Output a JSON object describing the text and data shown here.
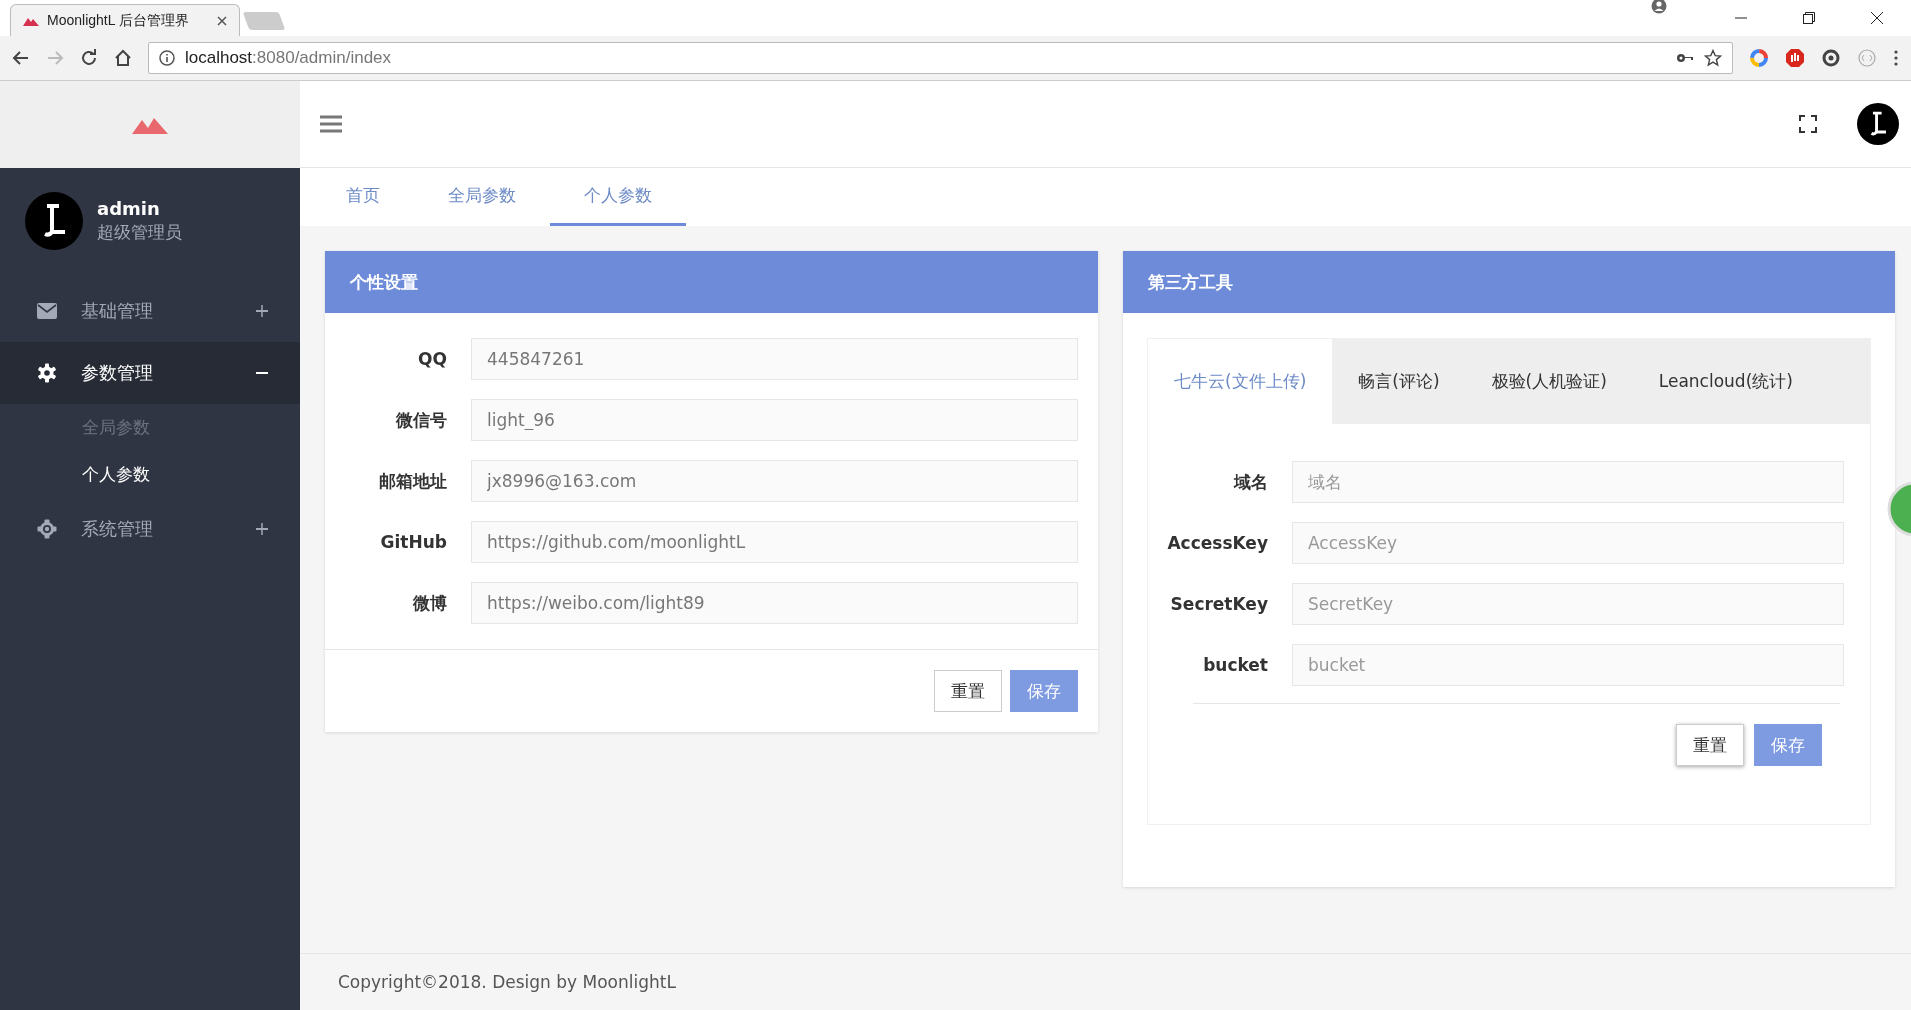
{
  "browser": {
    "tab_title": "MoonlightL 后台管理界",
    "url_host": "localhost",
    "url_rest": ":8080/admin/index"
  },
  "sidebar": {
    "user": {
      "name": "admin",
      "role": "超级管理员"
    },
    "menu": [
      {
        "label": "基础管理",
        "expanded": false,
        "selected": false
      },
      {
        "label": "参数管理",
        "expanded": true,
        "selected": true,
        "children": [
          {
            "label": "全局参数",
            "selected": false
          },
          {
            "label": "个人参数",
            "selected": true
          }
        ]
      },
      {
        "label": "系统管理",
        "expanded": false,
        "selected": false
      }
    ]
  },
  "tabs": [
    {
      "label": "首页",
      "selected": false
    },
    {
      "label": "全局参数",
      "selected": false
    },
    {
      "label": "个人参数",
      "selected": true
    }
  ],
  "personal_card": {
    "title": "个性设置",
    "fields": [
      {
        "label": "QQ",
        "value": "445847261"
      },
      {
        "label": "微信号",
        "value": "light_96"
      },
      {
        "label": "邮箱地址",
        "value": "jx8996@163.com"
      },
      {
        "label": "GitHub",
        "value": "https://github.com/moonlightL"
      },
      {
        "label": "微博",
        "value": "https://weibo.com/light89"
      }
    ],
    "buttons": [
      {
        "label": "重置",
        "kind": "default"
      },
      {
        "label": "保存",
        "kind": "primary"
      }
    ]
  },
  "tools_card": {
    "title": "第三方工具",
    "tabs": [
      {
        "label": "七牛云(文件上传)",
        "selected": true
      },
      {
        "label": "畅言(评论)",
        "selected": false
      },
      {
        "label": "极验(人机验证)",
        "selected": false
      },
      {
        "label": "Leancloud(统计)",
        "selected": false
      }
    ],
    "fields": [
      {
        "label": "域名",
        "placeholder": "域名"
      },
      {
        "label": "AccessKey",
        "placeholder": "AccessKey"
      },
      {
        "label": "SecretKey",
        "placeholder": "SecretKey"
      },
      {
        "label": "bucket",
        "placeholder": "bucket"
      }
    ],
    "buttons": [
      {
        "label": "重置",
        "kind": "default"
      },
      {
        "label": "保存",
        "kind": "primary"
      }
    ]
  },
  "footer": {
    "text": "Copyright©2018. Design by MoonlightL"
  }
}
